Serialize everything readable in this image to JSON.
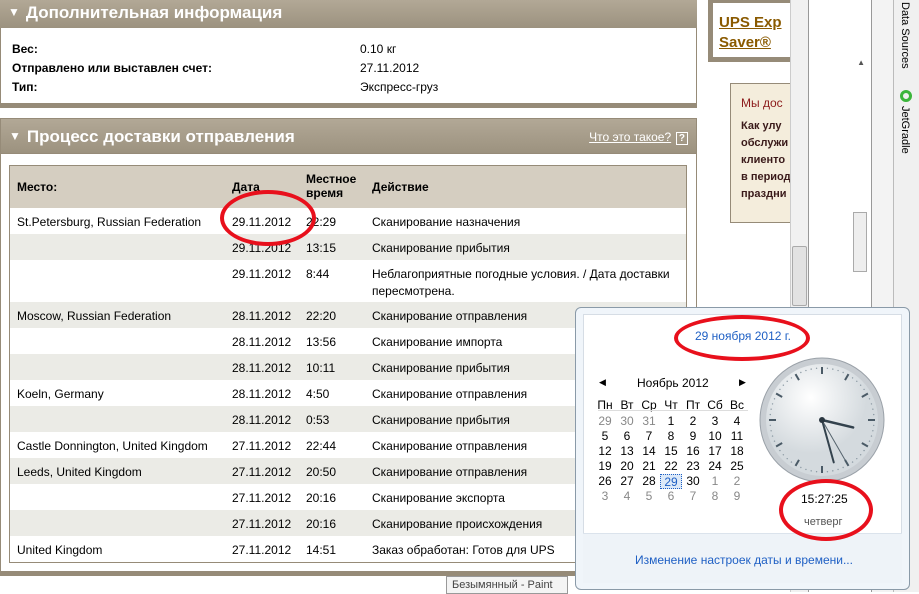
{
  "additional_info": {
    "title": "Дополнительная информация",
    "rows": [
      {
        "label": "Вес:",
        "value": "0.10 кг"
      },
      {
        "label": "Отправлено или выставлен счет:",
        "value": "27.11.2012"
      },
      {
        "label": "Тип:",
        "value": "Экспресс-груз"
      }
    ]
  },
  "delivery": {
    "title": "Процесс доставки отправления",
    "help_link": "Что это такое?",
    "headers": [
      "Место:",
      "Дата",
      "Местное время",
      "Действие"
    ],
    "rows": [
      [
        "St.Petersburg, Russian Federation",
        "29.11.2012",
        "22:29",
        "Сканирование назначения"
      ],
      [
        "",
        "29.11.2012",
        "13:15",
        "Сканирование прибытия"
      ],
      [
        "",
        "29.11.2012",
        "8:44",
        "Неблагоприятные погодные условия. / Дата доставки пересмотрена."
      ],
      [
        "Moscow, Russian Federation",
        "28.11.2012",
        "22:20",
        "Сканирование отправления"
      ],
      [
        "",
        "28.11.2012",
        "13:56",
        "Сканирование импорта"
      ],
      [
        "",
        "28.11.2012",
        "10:11",
        "Сканирование прибытия"
      ],
      [
        "Koeln, Germany",
        "28.11.2012",
        "4:50",
        "Сканирование отправления"
      ],
      [
        "",
        "28.11.2012",
        "0:53",
        "Сканирование прибытия"
      ],
      [
        "Castle Donnington, United Kingdom",
        "27.11.2012",
        "22:44",
        "Сканирование отправления"
      ],
      [
        "Leeds, United Kingdom",
        "27.11.2012",
        "20:50",
        "Сканирование отправления"
      ],
      [
        "",
        "27.11.2012",
        "20:16",
        "Сканирование экспорта"
      ],
      [
        "",
        "27.11.2012",
        "20:16",
        "Сканирование происхождения"
      ],
      [
        "United Kingdom",
        "27.11.2012",
        "14:51",
        "Заказ обработан: Готов для UPS"
      ]
    ]
  },
  "promo": {
    "link_line1": "UPS Exp",
    "link_line2": "Saver®",
    "notice_title": "Мы дос",
    "notice_lines": [
      "Как улу",
      "обслужи",
      "клиенто",
      "в период",
      "праздни"
    ]
  },
  "ide": {
    "tab1": "Data Sources",
    "tab2": "JetGradle"
  },
  "taskbar": {
    "paint": "Безымянный - Paint"
  },
  "calendar": {
    "long_date": "29 ноября 2012 г.",
    "month": "Ноябрь 2012",
    "weekdays": [
      "Пн",
      "Вт",
      "Ср",
      "Чт",
      "Пт",
      "Сб",
      "Вс"
    ],
    "days": [
      "29",
      "30",
      "31",
      "1",
      "2",
      "3",
      "4",
      "5",
      "6",
      "7",
      "8",
      "9",
      "10",
      "11",
      "12",
      "13",
      "14",
      "15",
      "16",
      "17",
      "18",
      "19",
      "20",
      "21",
      "22",
      "23",
      "24",
      "25",
      "26",
      "27",
      "28",
      "29",
      "30",
      "1",
      "2",
      "3",
      "4",
      "5",
      "6",
      "7",
      "8",
      "9"
    ],
    "selected_day": "29",
    "time": "15:27:25",
    "weekday": "четверг",
    "settings_link": "Изменение настроек даты и времени...",
    "accent": "#1e5fc4"
  }
}
